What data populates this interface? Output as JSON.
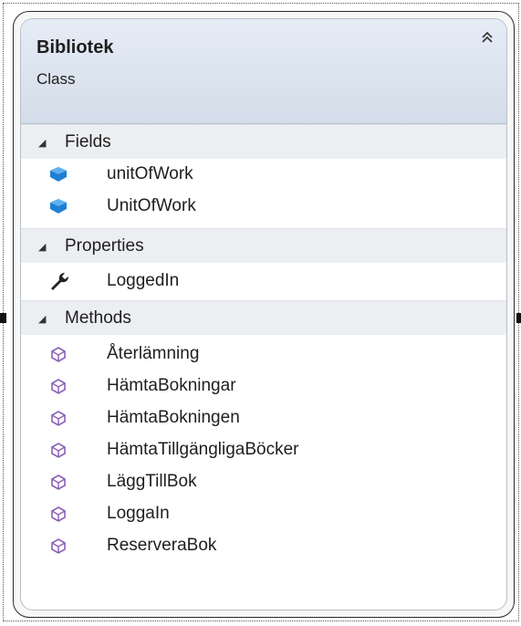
{
  "class_name": "Bibliotek",
  "stereotype": "Class",
  "sections": {
    "fields": {
      "label": "Fields",
      "items": [
        "unitOfWork",
        "UnitOfWork"
      ]
    },
    "properties": {
      "label": "Properties",
      "items": [
        "LoggedIn"
      ]
    },
    "methods": {
      "label": "Methods",
      "items": [
        "Återlämning",
        "HämtaBokningar",
        "HämtaBokningen",
        "HämtaTillgängligaBöcker",
        "LäggTillBok",
        "LoggaIn",
        "ReserveraBok"
      ]
    }
  },
  "icons": {
    "collapse": "double-chevron-up-icon",
    "section_toggle": "expanded-triangle-icon",
    "field": "field-icon",
    "property": "wrench-property-icon",
    "method": "method-cube-icon"
  },
  "colors": {
    "header_top": "#e6ecf6",
    "header_bottom": "#d3dde9",
    "section_bg": "#eceef1",
    "field_icon": "#1e7fd4",
    "method_icon": "#8a5fb8"
  }
}
